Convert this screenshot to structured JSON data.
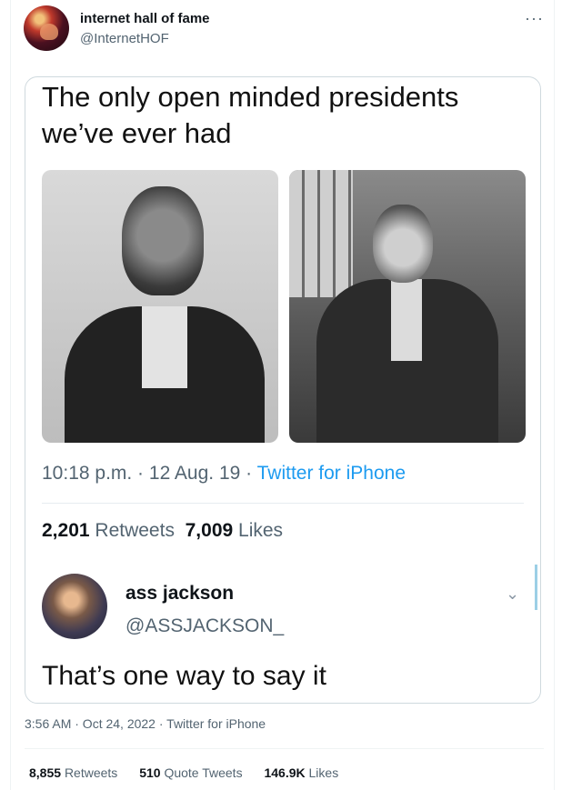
{
  "tweet": {
    "author_name": "internet hall of fame",
    "author_handle": "@InternetHOF",
    "more_label": "···",
    "timestamp": "3:56 AM · Oct 24, 2022 · Twitter for iPhone",
    "stats": {
      "retweets": {
        "count": "8,855",
        "label": "Retweets"
      },
      "quotes": {
        "count": "510",
        "label": "Quote Tweets"
      },
      "likes": {
        "count": "146.9K",
        "label": "Likes"
      }
    }
  },
  "quoted": {
    "text": "The only open minded presidents we’ve ever had",
    "meta_time": "10:18 p.m. · 12 Aug. 19 · ",
    "meta_source": "Twitter for iPhone",
    "retweets": {
      "count": "2,201",
      "label": "Retweets"
    },
    "likes": {
      "count": "7,009",
      "label": "Likes"
    },
    "reply": {
      "name": "ass jackson",
      "handle": "@ASSJACKSON_",
      "text": "That’s one way to say it"
    }
  }
}
